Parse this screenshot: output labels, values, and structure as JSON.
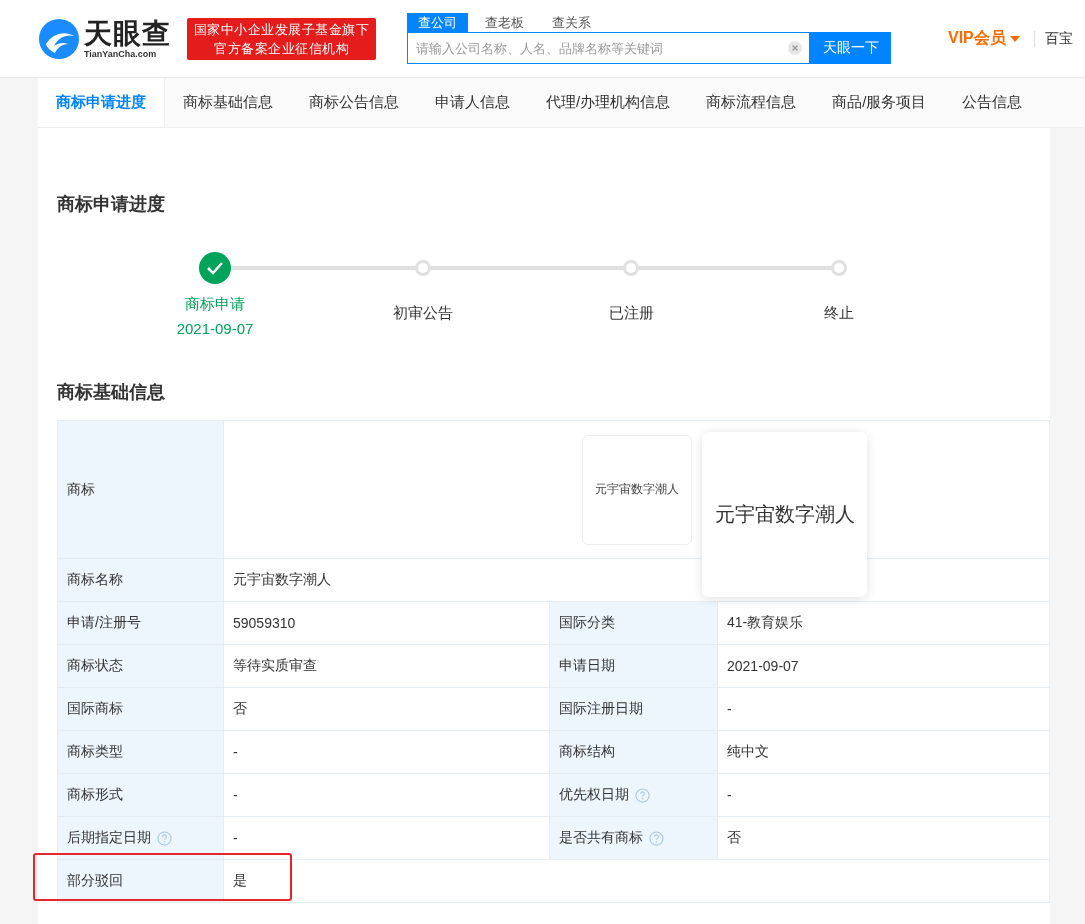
{
  "header": {
    "logo": {
      "name": "天眼查",
      "domain": "TianYanCha.com"
    },
    "badge": [
      "国家中小企业发展子基金旗下",
      "官方备案企业征信机构"
    ],
    "search": {
      "tabs": [
        {
          "label": "查公司",
          "selected": true
        },
        {
          "label": "查老板",
          "selected": false
        },
        {
          "label": "查关系",
          "selected": false
        }
      ],
      "placeholder": "请输入公司名称、人名、品牌名称等关键词",
      "button": "天眼一下"
    },
    "vip": "VIP会员",
    "nav_cut": "百宝"
  },
  "tabs": [
    {
      "label": "商标申请进度",
      "selected": true
    },
    {
      "label": "商标基础信息",
      "selected": false
    },
    {
      "label": "商标公告信息",
      "selected": false
    },
    {
      "label": "申请人信息",
      "selected": false
    },
    {
      "label": "代理/办理机构信息",
      "selected": false
    },
    {
      "label": "商标流程信息",
      "selected": false
    },
    {
      "label": "商品/服务项目",
      "selected": false
    },
    {
      "label": "公告信息",
      "selected": false
    }
  ],
  "progress": {
    "title": "商标申请进度",
    "steps": [
      {
        "label": "商标申请",
        "date": "2021-09-07",
        "done": true
      },
      {
        "label": "初审公告",
        "done": false
      },
      {
        "label": "已注册",
        "done": false
      },
      {
        "label": "终止",
        "done": false
      }
    ]
  },
  "basic_info": {
    "title": "商标基础信息",
    "trademark": {
      "label": "商标",
      "image_text": "元宇宙数字潮人",
      "preview_text": "元宇宙数字潮人"
    },
    "rows": [
      {
        "cells": [
          {
            "label": "商标名称",
            "value": "元宇宙数字潮人"
          }
        ]
      },
      {
        "cells": [
          {
            "label": "申请/注册号",
            "value": "59059310"
          },
          {
            "label": "国际分类",
            "value": "41-教育娱乐"
          }
        ]
      },
      {
        "cells": [
          {
            "label": "商标状态",
            "value": "等待实质审查"
          },
          {
            "label": "申请日期",
            "value": "2021-09-07"
          }
        ]
      },
      {
        "cells": [
          {
            "label": "国际商标",
            "value": "否"
          },
          {
            "label": "国际注册日期",
            "value": "-"
          }
        ]
      },
      {
        "cells": [
          {
            "label": "商标类型",
            "value": "-"
          },
          {
            "label": "商标结构",
            "value": "纯中文"
          }
        ]
      },
      {
        "cells": [
          {
            "label": "商标形式",
            "value": "-"
          },
          {
            "label": "优先权日期",
            "value": "-",
            "help": true
          }
        ]
      },
      {
        "cells": [
          {
            "label": "后期指定日期",
            "value": "-",
            "help": true
          },
          {
            "label": "是否共有商标",
            "value": "否",
            "help": true
          }
        ]
      },
      {
        "cells": [
          {
            "label": "部分驳回",
            "value": "是"
          }
        ],
        "highlighted": true
      }
    ]
  }
}
